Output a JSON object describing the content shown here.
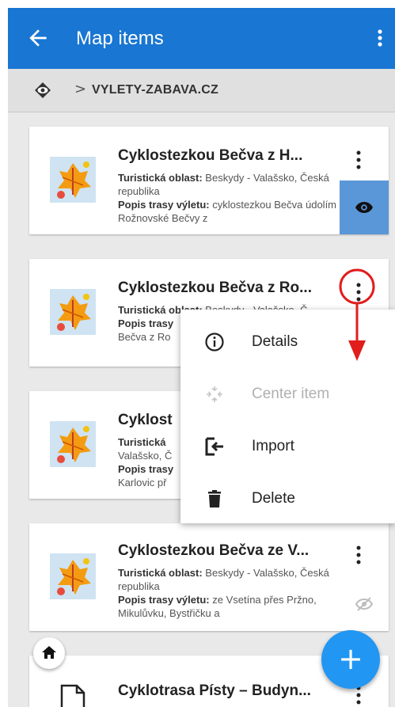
{
  "appbar": {
    "title": "Map items",
    "back_icon": "arrow-back-icon",
    "more_icon": "more-vert-icon"
  },
  "breadcrumb": {
    "root_icon": "eye-layers-icon",
    "separator": ">",
    "folder": "VYLETY-ZABAVA.CZ"
  },
  "items": [
    {
      "title": "Cyklostezkou Bečva z H...",
      "area_label": "Turistická oblast:",
      "area_value": " Beskydy - Valašsko, Česká republika",
      "route_label": "Popis trasy výletu:",
      "route_value": " cyklostezkou Bečva údolím Rožnovské Bečvy z",
      "visibility": "visible"
    },
    {
      "title": "Cyklostezkou Bečva z Ro...",
      "area_label": "Turistická oblast:",
      "area_value": " Beskydy - Valašsko, Č",
      "route_label": "Popis trasy",
      "route_value": "Bečva z Ro",
      "visibility": "covered"
    },
    {
      "title": "Cyklost",
      "area_label": "Turistická",
      "area_value": "Valašsko, Č",
      "route_label": "Popis trasy",
      "route_value": "Karlovic př",
      "visibility": "covered"
    },
    {
      "title": "Cyklostezkou Bečva ze V...",
      "area_label": "Turistická oblast:",
      "area_value": " Beskydy - Valašsko, Česká republika",
      "route_label": "Popis trasy výletu:",
      "route_value": " ze Vsetína přes Pržno, Mikulůvku, Bystřičku a",
      "visibility": "hidden"
    },
    {
      "title": "Cyklotrasa Písty – Budyn...",
      "visibility": "none"
    }
  ],
  "menu": {
    "items": [
      {
        "label": "Details",
        "icon": "info-icon",
        "enabled": true
      },
      {
        "label": "Center item",
        "icon": "center-focus-icon",
        "enabled": false
      },
      {
        "label": "Import",
        "icon": "import-icon",
        "enabled": true
      },
      {
        "label": "Delete",
        "icon": "trash-icon",
        "enabled": true
      }
    ]
  },
  "fab": {
    "home_icon": "home-icon",
    "add_label": "+"
  },
  "colors": {
    "appbar": "#1976d2",
    "accent": "#2196f3",
    "visible_toggle": "#5a97d8",
    "annotation": "#e11d1d"
  }
}
